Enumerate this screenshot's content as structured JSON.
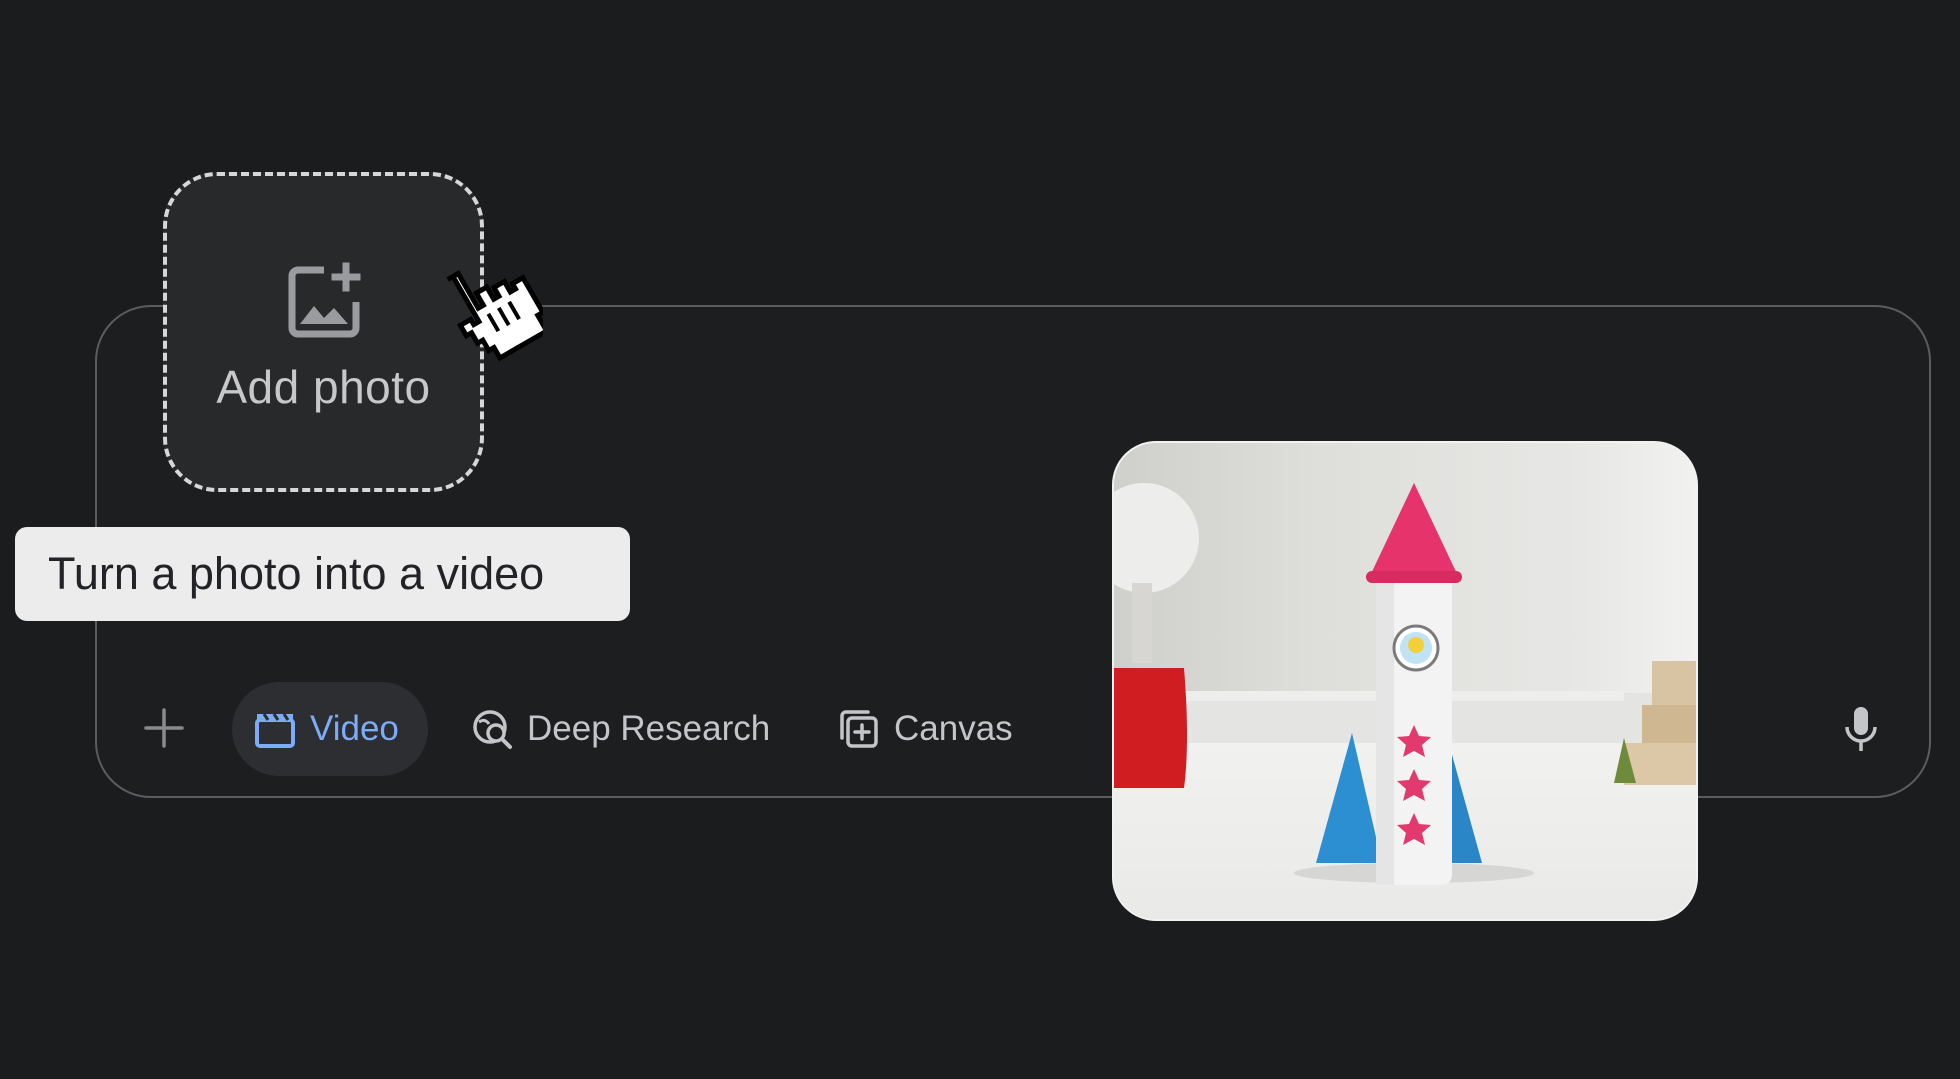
{
  "upload": {
    "label": "Add photo",
    "icon": "add-photo-icon"
  },
  "tooltip": {
    "text": "Turn a photo into a video"
  },
  "toolbar": {
    "plus_icon": "plus-icon",
    "chips": {
      "video": {
        "label": "Video",
        "icon": "clapperboard-icon",
        "active": true,
        "color": "#7cacf8"
      },
      "deep_research": {
        "label": "Deep Research",
        "icon": "deep-research-icon",
        "active": false
      },
      "canvas": {
        "label": "Canvas",
        "icon": "canvas-icon",
        "active": false
      }
    },
    "mic_icon": "microphone-icon"
  },
  "preview": {
    "subject": "paper-rocket-photo"
  },
  "colors": {
    "background": "#1b1c1e",
    "accent": "#7cacf8",
    "tooltip_bg": "#ececec"
  }
}
